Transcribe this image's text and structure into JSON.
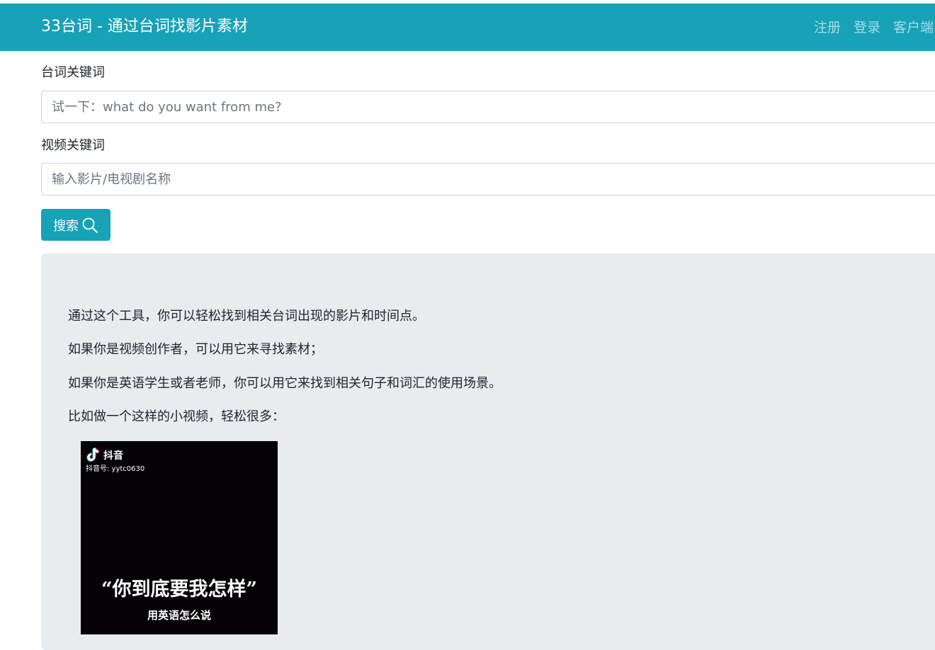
{
  "header": {
    "brand": "33台词 - 通过台词找影片素材",
    "nav": {
      "register": "注册",
      "login": "登录",
      "client": "客户端"
    }
  },
  "form": {
    "line_label": "台词关键词",
    "line_placeholder": "试一下：what do you want from me?",
    "video_label": "视频关键词",
    "video_placeholder": "输入影片/电视剧名称",
    "search_label": "搜索"
  },
  "intro": {
    "lines": [
      "通过这个工具，你可以轻松找到相关台词出现的影片和时间点。",
      "如果你是视频创作者，可以用它来寻找素材；",
      "如果你是英语学生或者老师，你可以用它来找到相关句子和词汇的使用场景。",
      "比如做一个这样的小视频，轻松很多："
    ]
  },
  "video": {
    "app_name": "抖音",
    "account": "抖音号: yytc0630",
    "caption": "“你到底要我怎样”",
    "subcaption": "用英语怎么说"
  },
  "icons": {
    "search": "search-icon",
    "tiktok": "tiktok-logo-icon"
  },
  "colors": {
    "primary": "#17a2b8",
    "jumbotron": "#e9ecef"
  }
}
